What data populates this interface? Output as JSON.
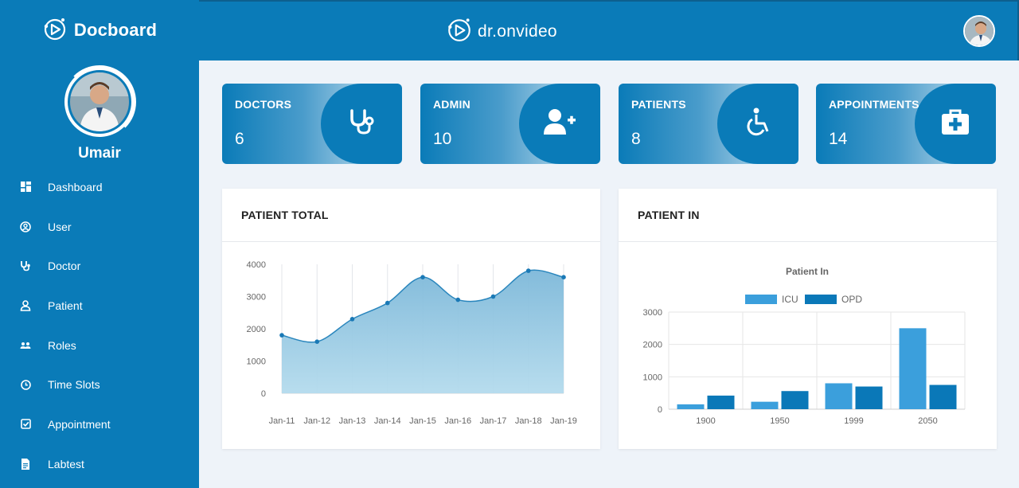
{
  "sidebar": {
    "brand": "Docboard",
    "username": "Umair",
    "items": [
      {
        "label": "Dashboard",
        "icon": "dashboard-icon"
      },
      {
        "label": "User",
        "icon": "user-circle-icon"
      },
      {
        "label": "Doctor",
        "icon": "stethoscope-icon"
      },
      {
        "label": "Patient",
        "icon": "patient-icon"
      },
      {
        "label": "Roles",
        "icon": "roles-icon"
      },
      {
        "label": "Time Slots",
        "icon": "clock-icon"
      },
      {
        "label": "Appointment",
        "icon": "checkbox-icon"
      },
      {
        "label": "Labtest",
        "icon": "file-icon"
      }
    ]
  },
  "topbar": {
    "brand": "dr.onvideo"
  },
  "stats": [
    {
      "title": "DOCTORS",
      "value": "6",
      "icon": "stethoscope-icon"
    },
    {
      "title": "ADMIN",
      "value": "10",
      "icon": "user-plus-icon"
    },
    {
      "title": "PATIENTS",
      "value": "8",
      "icon": "wheelchair-icon"
    },
    {
      "title": "APPOINTMENTS",
      "value": "14",
      "icon": "medkit-icon"
    }
  ],
  "colors": {
    "primary": "#0a7bb8",
    "icu": "#3b9fdc",
    "opd": "#0a78b8",
    "area_fill": "#8ec5e0"
  },
  "panels": {
    "patient_total": {
      "title": "PATIENT TOTAL"
    },
    "patient_in": {
      "title": "PATIENT IN"
    }
  },
  "chart_data": [
    {
      "type": "area",
      "title": "",
      "categories": [
        "Jan-11",
        "Jan-12",
        "Jan-13",
        "Jan-14",
        "Jan-15",
        "Jan-16",
        "Jan-17",
        "Jan-18",
        "Jan-19"
      ],
      "values": [
        1800,
        1600,
        2300,
        2800,
        3600,
        2900,
        3000,
        3800,
        3600
      ],
      "ylim": [
        0,
        4000
      ],
      "yticks": [
        0,
        1000,
        2000,
        3000,
        4000
      ],
      "grid": "vertical"
    },
    {
      "type": "bar",
      "title": "Patient In",
      "categories": [
        "1900",
        "1950",
        "1999",
        "2050"
      ],
      "series": [
        {
          "name": "ICU",
          "values": [
            150,
            230,
            800,
            2500
          ]
        },
        {
          "name": "OPD",
          "values": [
            420,
            560,
            700,
            750
          ]
        }
      ],
      "ylim": [
        0,
        3000
      ],
      "yticks": [
        0,
        1000,
        2000,
        3000
      ],
      "legend": "top",
      "grid": "both"
    }
  ]
}
